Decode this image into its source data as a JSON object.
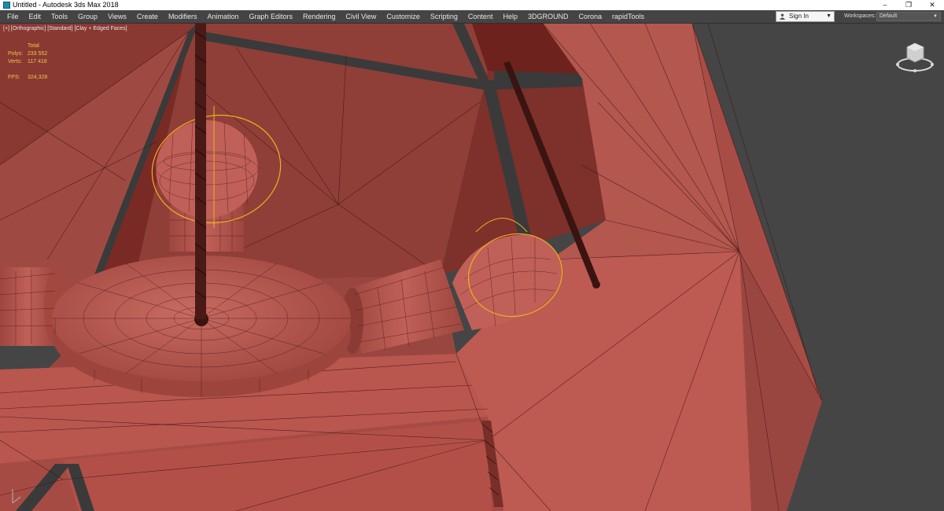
{
  "window": {
    "title": "Untitled - Autodesk 3ds Max 2018",
    "controls": [
      "–",
      "❐",
      "✕"
    ]
  },
  "menubar": {
    "items": [
      "File",
      "Edit",
      "Tools",
      "Group",
      "Views",
      "Create",
      "Modifiers",
      "Animation",
      "Graph Editors",
      "Rendering",
      "Civil View",
      "Customize",
      "Scripting",
      "Content",
      "Help",
      "3DGROUND",
      "Corona",
      "rapidTools"
    ],
    "sign_in": "Sign In",
    "workspaces_label": "Workspaces:",
    "workspaces_value": "Default"
  },
  "viewport": {
    "label": "[+] [Orthographic] [Standard] [Clay + Edged Faces]",
    "stats": {
      "header": "Total",
      "polys_label": "Polys:",
      "polys_value": "233 552",
      "verts_label": "Verts:",
      "verts_value": "117 418",
      "fps_label": "FPS:",
      "fps_value": "324,328"
    }
  },
  "colors": {
    "clay": "#b2524a",
    "clay_dark": "#8c3a34",
    "clay_light": "#c4605a",
    "wire": "#3a1410",
    "selection": "#f0b020",
    "background": "#454545",
    "stats_text": "#e8c94a"
  },
  "icons": [
    "app-icon",
    "user-icon",
    "caret-down-icon",
    "viewcube-icon",
    "axis-tripod-icon"
  ]
}
